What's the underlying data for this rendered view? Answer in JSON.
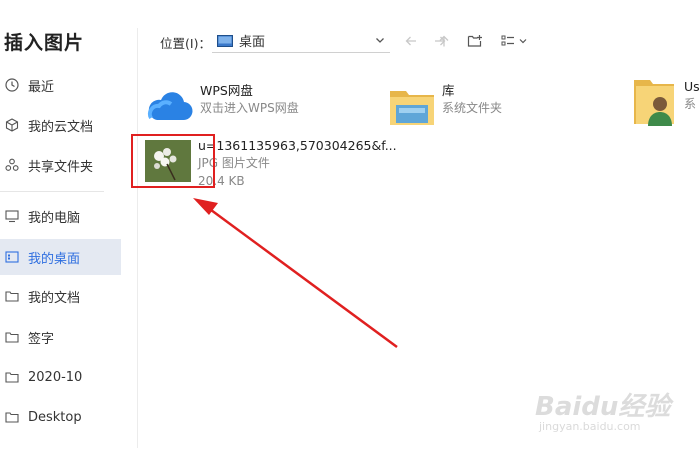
{
  "sidebar": {
    "title": "插入图片",
    "items": [
      {
        "label": "最近",
        "icon": "clock-icon"
      },
      {
        "label": "我的云文档",
        "icon": "cube-icon"
      },
      {
        "label": "共享文件夹",
        "icon": "share-icon"
      },
      {
        "label": "我的电脑",
        "icon": "monitor-icon"
      },
      {
        "label": "我的桌面",
        "icon": "desktop-icon",
        "active": true
      },
      {
        "label": "我的文档",
        "icon": "folder-icon"
      },
      {
        "label": "签字",
        "icon": "folder-icon"
      },
      {
        "label": "2020-10",
        "icon": "folder-icon"
      },
      {
        "label": "Desktop",
        "icon": "folder-icon"
      }
    ]
  },
  "toolbar": {
    "location_label": "位置(I)：",
    "location_value": "桌面"
  },
  "files": [
    {
      "name": "WPS网盘",
      "sub": "双击进入WPS网盘",
      "icon": "cloud-icon"
    },
    {
      "name": "库",
      "sub": "系统文件夹",
      "icon": "library-folder-icon"
    },
    {
      "name": "Us",
      "sub": "系",
      "icon": "user-folder-icon"
    },
    {
      "name": "u=1361135963,570304265&f...",
      "sub": "JPG 图片文件",
      "size": "20.4 KB",
      "icon": "image-thumbnail"
    }
  ],
  "watermark": {
    "main": "Baidu经验",
    "sub": "jingyan.baidu.com"
  },
  "colors": {
    "accent": "#2f6fe0",
    "active_bg": "#e4e9f2",
    "annotation": "#e02020"
  }
}
